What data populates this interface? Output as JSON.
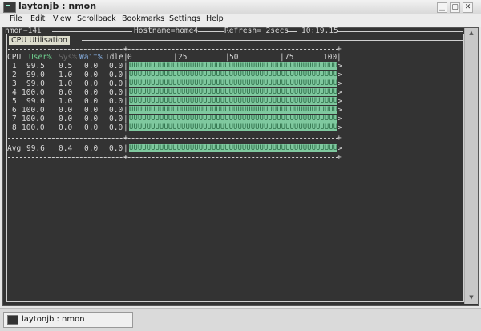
{
  "window": {
    "title": "laytonjb : nmon",
    "min_icon": "minimize-icon",
    "max_icon": "maximize-icon",
    "close_icon": "close-icon"
  },
  "menu": [
    "File",
    "Edit",
    "View",
    "Scrollback",
    "Bookmarks",
    "Settings",
    "Help"
  ],
  "header": {
    "version": "nmon−14i",
    "hostname": "Hostname=home4",
    "refresh": "Refresh= 2secs",
    "time": "10:19.15"
  },
  "panel": {
    "title": "CPU Utilisation"
  },
  "columns": {
    "cpu": "CPU",
    "user": "User%",
    "sys": "Sys%",
    "wait": "Wait%",
    "idle": "Idle"
  },
  "scale": {
    "s0": "0",
    "s25": "25",
    "s50": "50",
    "s75": "75",
    "s100": "100"
  },
  "rows": [
    {
      "cpu": "1",
      "user": "99.5",
      "sys": "0.5",
      "wait": "0.0",
      "idle": "0.0",
      "bar": "UUUUUUUUUUUUUUUUUUUUUUUUUUUUUUUUUUUUUUUUUUUUUUUUUU",
      "end": ">"
    },
    {
      "cpu": "2",
      "user": "99.0",
      "sys": "1.0",
      "wait": "0.0",
      "idle": "0.0",
      "bar": "UUUUUUUUUUUUUUUUUUUUUUUUUUUUUUUUUUUUUUUUUUUUUUUUUU",
      "end": ">"
    },
    {
      "cpu": "3",
      "user": "99.0",
      "sys": "1.0",
      "wait": "0.0",
      "idle": "0.0",
      "bar": "UUUUUUUUUUUUUUUUUUUUUUUUUUUUUUUUUUUUUUUUUUUUUUUUUU",
      "end": ">"
    },
    {
      "cpu": "4",
      "user": "100.0",
      "sys": "0.0",
      "wait": "0.0",
      "idle": "0.0",
      "bar": "UUUUUUUUUUUUUUUUUUUUUUUUUUUUUUUUUUUUUUUUUUUUUUUUUU",
      "end": ">"
    },
    {
      "cpu": "5",
      "user": "99.0",
      "sys": "1.0",
      "wait": "0.0",
      "idle": "0.0",
      "bar": "UUUUUUUUUUUUUUUUUUUUUUUUUUUUUUUUUUUUUUUUUUUUUUUUUU",
      "end": ">"
    },
    {
      "cpu": "6",
      "user": "100.0",
      "sys": "0.0",
      "wait": "0.0",
      "idle": "0.0",
      "bar": "UUUUUUUUUUUUUUUUUUUUUUUUUUUUUUUUUUUUUUUUUUUUUUUUUU",
      "end": ">"
    },
    {
      "cpu": "7",
      "user": "100.0",
      "sys": "0.0",
      "wait": "0.0",
      "idle": "0.0",
      "bar": "UUUUUUUUUUUUUUUUUUUUUUUUUUUUUUUUUUUUUUUUUUUUUUUUUU",
      "end": ">"
    },
    {
      "cpu": "8",
      "user": "100.0",
      "sys": "0.0",
      "wait": "0.0",
      "idle": "0.0",
      "bar": "UUUUUUUUUUUUUUUUUUUUUUUUUUUUUUUUUUUUUUUUUUUUUUUUUU",
      "end": ">"
    }
  ],
  "avg": {
    "cpu": "Avg",
    "user": "99.6",
    "sys": "0.4",
    "wait": "0.0",
    "idle": "0.0",
    "bar": "UUUUUUUUUUUUUUUUUUUUUUUUUUUUUUUUUUUUUUUUUUUUUUUUUU",
    "end": ">"
  },
  "taskbar": {
    "label": "laytonjb : nmon"
  }
}
